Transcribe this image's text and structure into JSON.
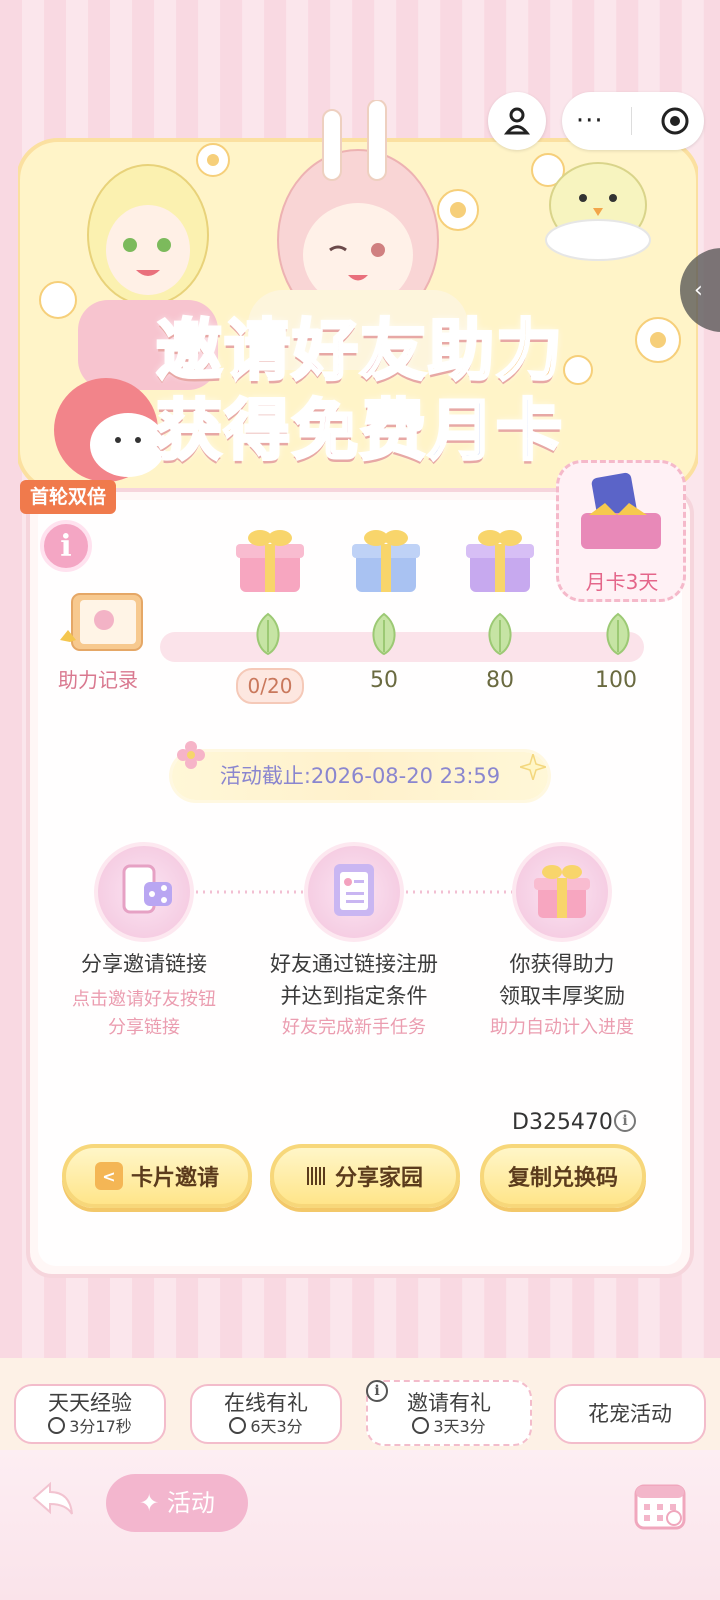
{
  "header": {
    "capsule_more": "···",
    "side_tab_icon": "chevron-left-icon"
  },
  "banner": {
    "title_line1_part1": "邀请好友",
    "title_line1_part2": "助力",
    "title_line2_part1": "获得",
    "title_line2_part2": "免费",
    "title_line2_part3": "月卡"
  },
  "badge": "首轮双倍",
  "progress": {
    "record_label": "助力记录",
    "current": "0/20",
    "milestones": [
      "50",
      "80",
      "100"
    ],
    "final_reward": "月卡3天",
    "value": 0,
    "max": 100
  },
  "deadline": "活动截止:2026-08-20 23:59",
  "steps": [
    {
      "title1": "分享邀请链接",
      "title2": "",
      "sub1": "点击邀请好友按钮",
      "sub2": "分享链接"
    },
    {
      "title1": "好友通过链接注册",
      "title2": "并达到指定条件",
      "sub1": "好友完成新手任务",
      "sub2": ""
    },
    {
      "title1": "你获得助力",
      "title2": "领取丰厚奖励",
      "sub1": "助力自动计入进度",
      "sub2": ""
    }
  ],
  "code": "D325470",
  "buttons": {
    "card_invite": "卡片邀请",
    "share_home": "分享家园",
    "copy_code": "复制兑换码"
  },
  "tabs": [
    {
      "label": "天天经验",
      "time": "3分17秒"
    },
    {
      "label": "在线有礼",
      "time": "6天3分"
    },
    {
      "label": "邀请有礼",
      "time": "3天3分"
    },
    {
      "label": "花宠活动",
      "time": ""
    }
  ],
  "bottom": {
    "activity_label": "活动"
  },
  "colors": {
    "accent_pink": "#e36f85",
    "accent_orange": "#f4a93e",
    "accent_blue": "#6d8ee6"
  }
}
